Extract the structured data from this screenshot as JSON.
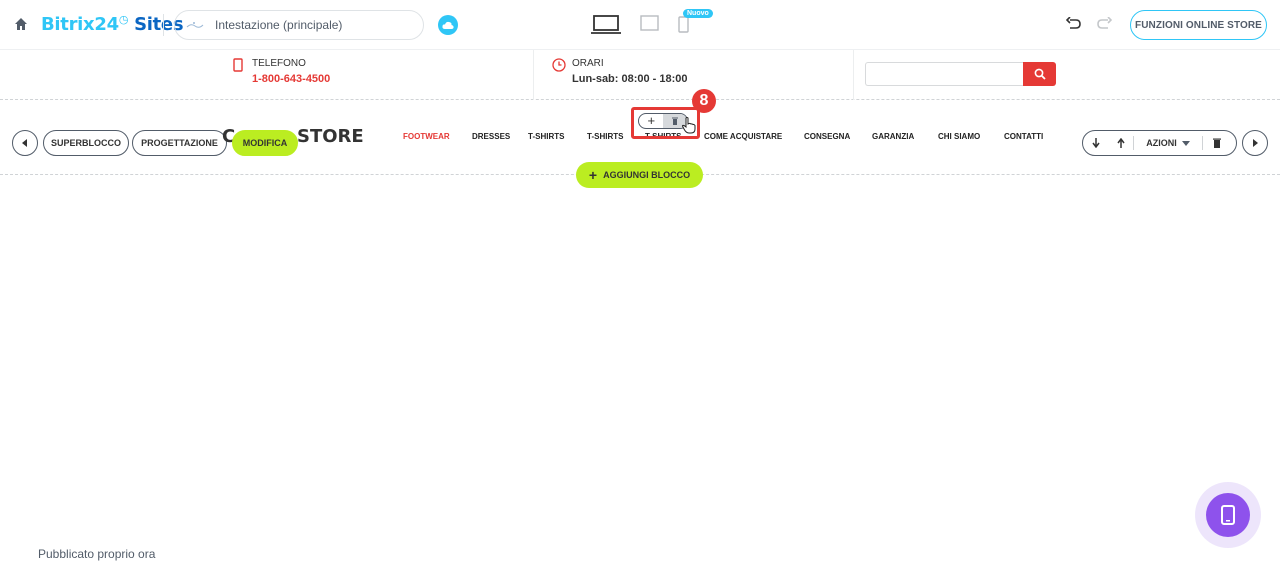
{
  "topbar": {
    "logo_b24": "Bitrix24",
    "logo_clock": "◷",
    "logo_sites": " Sites",
    "page_selector": "Intestazione (principale)",
    "new_badge": "Nuovo",
    "store_button": "FUNZIONI ONLINE STORE"
  },
  "header": {
    "phone_label": "TELEFONO",
    "phone_value": "1-800-643-4500",
    "hours_label": "ORARI",
    "hours_value": "Lun-sab: 08:00 - 18:00",
    "search_placeholder": ""
  },
  "block_toolbar": {
    "superblocco": "SUPERBLOCCO",
    "progettazione": "PROGETTAZIONE",
    "modifica": "MODIFICA",
    "brand_left": "C",
    "brand_right": "STORE",
    "azioni": "AZIONI",
    "add_block": "AGGIUNGI BLOCCO",
    "step_number": "8"
  },
  "menu": [
    {
      "label": "FOOTWEAR",
      "active": true
    },
    {
      "label": "DRESSES",
      "active": false
    },
    {
      "label": "T-SHIRTS",
      "active": false
    },
    {
      "label": "T-SHIRTS",
      "active": false
    },
    {
      "label": "T-SHIRTS",
      "active": false
    },
    {
      "label": "COME ACQUISTARE",
      "active": false
    },
    {
      "label": "CONSEGNA",
      "active": false
    },
    {
      "label": "GARANZIA",
      "active": false
    },
    {
      "label": "CHI SIAMO",
      "active": false
    },
    {
      "label": "CONTATTI",
      "active": false
    }
  ],
  "footer": {
    "published": "Pubblicato proprio ora"
  },
  "colors": {
    "accent_blue": "#2fc6f6",
    "brand_blue": "#0b66c3",
    "highlight_red": "#e53935",
    "lime": "#bbed21",
    "purple": "#8e52ec"
  }
}
